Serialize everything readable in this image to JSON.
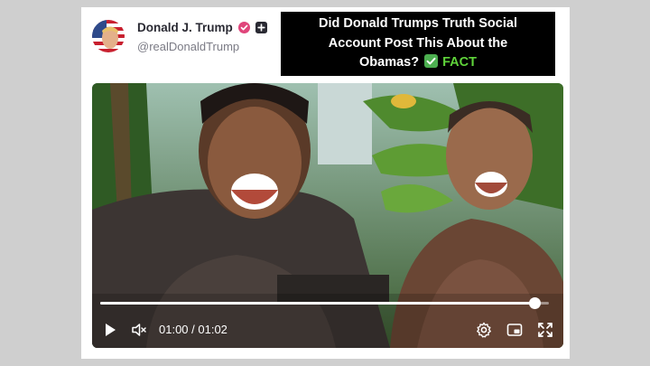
{
  "post": {
    "author_name": "Donald J. Trump",
    "handle": "@realDonaldTrump"
  },
  "headline": {
    "line1": "Did Donald Trumps Truth Social",
    "line2": "Account Post This About the",
    "line3": "Obamas?",
    "verdict": "FACT"
  },
  "video": {
    "current_time": "01:00",
    "duration": "01:02",
    "time_display": "01:00 / 01:02",
    "progress": 0.968
  },
  "icons": {
    "verified": "verified-badge-icon",
    "plus": "plus-badge-icon",
    "play": "play-icon",
    "mute": "mute-icon",
    "settings": "settings-icon",
    "pip": "picture-in-picture-icon",
    "fullscreen": "fullscreen-icon"
  },
  "colors": {
    "verified_badge": "#e0457b",
    "verdict_text": "#5fd33a",
    "check_bg": "#4caf50"
  }
}
